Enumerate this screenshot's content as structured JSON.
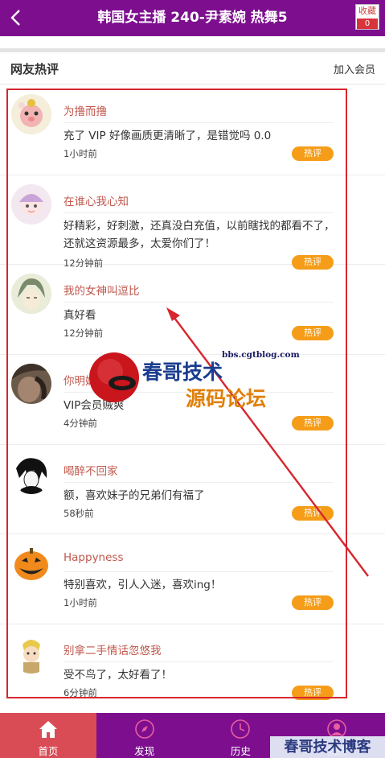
{
  "header": {
    "title": "韩国女主播 240-尹素婉 热舞5",
    "fav_label": "收藏",
    "fav_count": "0"
  },
  "section": {
    "title": "网友热评",
    "join": "加入会员"
  },
  "comments": [
    {
      "name": "为撸而撸",
      "text": "充了 VIP 好像画质更清晰了，是错觉吗 0.0",
      "time": "1小时前",
      "badge": "热评"
    },
    {
      "name": "在谁心我心知",
      "text": "好精彩，好刺激，还真没白充值，以前瞎找的都看不了，还就这资源最多，太爱你们了！",
      "time": "12分钟前",
      "badge": "热评"
    },
    {
      "name": "我的女神叫逗比",
      "text": "真好看",
      "time": "12分钟前",
      "badge": "热评"
    },
    {
      "name": "你明媚",
      "text": "VIP会员贼爽",
      "time": "4分钟前",
      "badge": "热评"
    },
    {
      "name": "喝醉不回家",
      "text": "额，喜欢妹子的兄弟们有福了",
      "time": "58秒前",
      "badge": "热评"
    },
    {
      "name": "Happyness",
      "text": "特别喜欢，引人入迷，喜欢ing！",
      "time": "1小时前",
      "badge": "热评"
    },
    {
      "name": "别拿二手情话忽悠我",
      "text": "受不鸟了，太好看了！",
      "time": "6分钟前",
      "badge": "热评"
    }
  ],
  "tabs": [
    {
      "label": "首页",
      "icon": "home-icon"
    },
    {
      "label": "发现",
      "icon": "compass-icon"
    },
    {
      "label": "历史",
      "icon": "clock-icon"
    },
    {
      "label": "我的",
      "icon": "user-icon"
    }
  ],
  "watermark": {
    "site": "bbs.cgtblog.com",
    "line1": "春哥技术",
    "line2": "源码论坛",
    "blog": "春哥技术博客"
  },
  "colors": {
    "header": "#7d0f8f",
    "badge": "#f59d19",
    "name": "#c0584d",
    "active_tab": "#d94c55"
  }
}
